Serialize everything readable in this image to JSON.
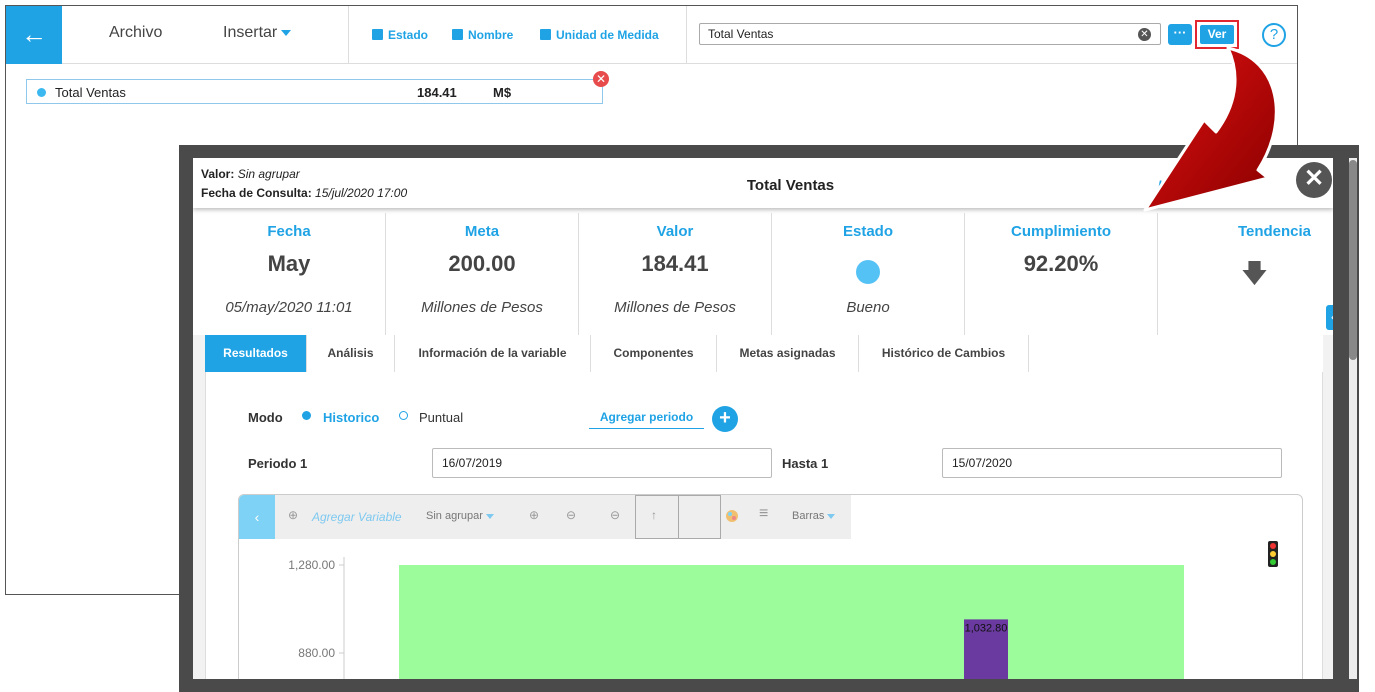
{
  "toolbar": {
    "back_icon": "←",
    "archivo": "Archivo",
    "insertar": "Insertar",
    "chk_estado": "Estado",
    "chk_nombre": "Nombre",
    "chk_unidad": "Unidad de Medida",
    "search_value": "Total Ventas",
    "more_label": "···",
    "ver_label": "Ver",
    "help_label": "?",
    "clear_label": "✕"
  },
  "row": {
    "name": "Total Ventas",
    "value": "184.41",
    "unit": "M$",
    "close_label": "✕"
  },
  "dialog": {
    "valor_label": "Valor:",
    "valor_value": "Sin agrupar",
    "fecha_label": "Fecha de Consulta:",
    "fecha_value": "15/jul/2020 17:00",
    "title": "Total Ventas",
    "ing_link": "Ingr",
    "close_label": "✕",
    "side_tab_label": "‹"
  },
  "stats": [
    {
      "label": "Fecha",
      "big": "May",
      "sub": "05/may/2020 11:01"
    },
    {
      "label": "Meta",
      "big": "200.00",
      "sub": "Millones de Pesos"
    },
    {
      "label": "Valor",
      "big": "184.41",
      "sub": "Millones de Pesos"
    },
    {
      "label": "Estado",
      "big": "",
      "sub": "Bueno"
    },
    {
      "label": "Cumplimiento",
      "big": "92.20%",
      "sub": ""
    },
    {
      "label": "Tendencia",
      "big": "🡇",
      "sub": ""
    }
  ],
  "tabs": [
    "Resultados",
    "Análisis",
    "Información de la variable",
    "Componentes",
    "Metas asignadas",
    "Histórico de Cambios"
  ],
  "form": {
    "modo_label": "Modo",
    "historico": "Historico",
    "puntual": "Puntual",
    "agregar_periodo": "Agregar periodo",
    "add_btn": "+",
    "periodo_label": "Periodo 1",
    "periodo_value": "16/07/2019",
    "hasta_label": "Hasta 1",
    "hasta_value": "15/07/2020"
  },
  "chart_toolbar": {
    "back": "‹",
    "add_icon": "⊕",
    "agregar_variable": "Agregar Variable",
    "group": "Sin agrupar",
    "zoom_in": "⊕",
    "zoom_out": "⊖",
    "remove": "⊖",
    "up": "↑",
    "list_icon": "≡",
    "chart_type": "Barras"
  },
  "colors": {
    "accent": "#1fa3e5",
    "goal_band": "#9cfc9c",
    "bar": "#6a3aa0",
    "close_red": "#e84b4b",
    "arrow_red": "#c40000"
  },
  "chart_data": {
    "type": "bar",
    "y_ticks": [
      1280,
      880
    ],
    "y_tick_labels": [
      "1,280.00",
      "880.00"
    ],
    "bars": [
      {
        "value": 1032.8,
        "label": "1,032.80"
      }
    ],
    "band": {
      "from_value": 1280
    },
    "ylim": [
      600,
      1320
    ]
  }
}
